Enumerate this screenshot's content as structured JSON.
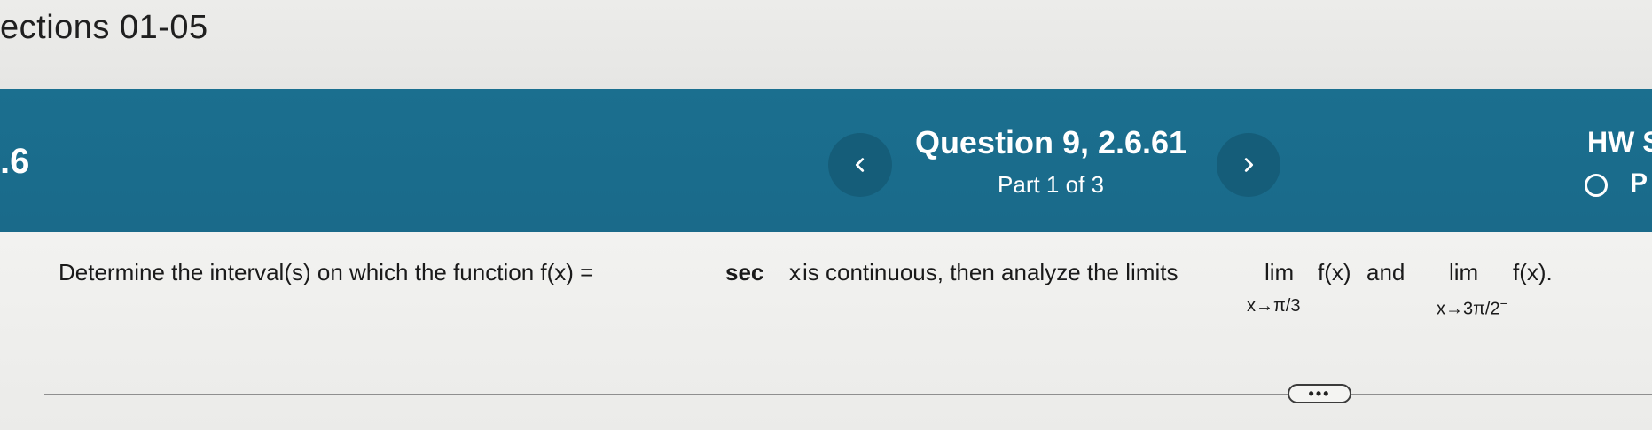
{
  "header": {
    "section_title": "ections 01-05"
  },
  "banner": {
    "section_number": ".6",
    "question_title": "Question 9, 2.6.61",
    "question_part": "Part 1 of 3",
    "hw_label": "HW S",
    "status_letter": "P",
    "prev_icon": "chevron-left-icon",
    "next_icon": "chevron-right-icon",
    "colors": {
      "banner": "#1a6c8c",
      "nav_button": "#155d79"
    }
  },
  "question": {
    "intro": "Determine the interval(s) on which the function f(x) = ",
    "func_name": "sec",
    "func_arg": "x",
    "after_func": " is continuous, then analyze the limits",
    "lim1_word": "lim",
    "lim1_expr": "f(x)",
    "and_word": "and",
    "lim2_word": "lim",
    "lim2_expr": "f(x).",
    "lim1_sub": "x→π/3",
    "lim2_sub": "x→3π/2",
    "lim2_sub_sup": "−"
  },
  "more_button": {
    "label": "•••"
  }
}
